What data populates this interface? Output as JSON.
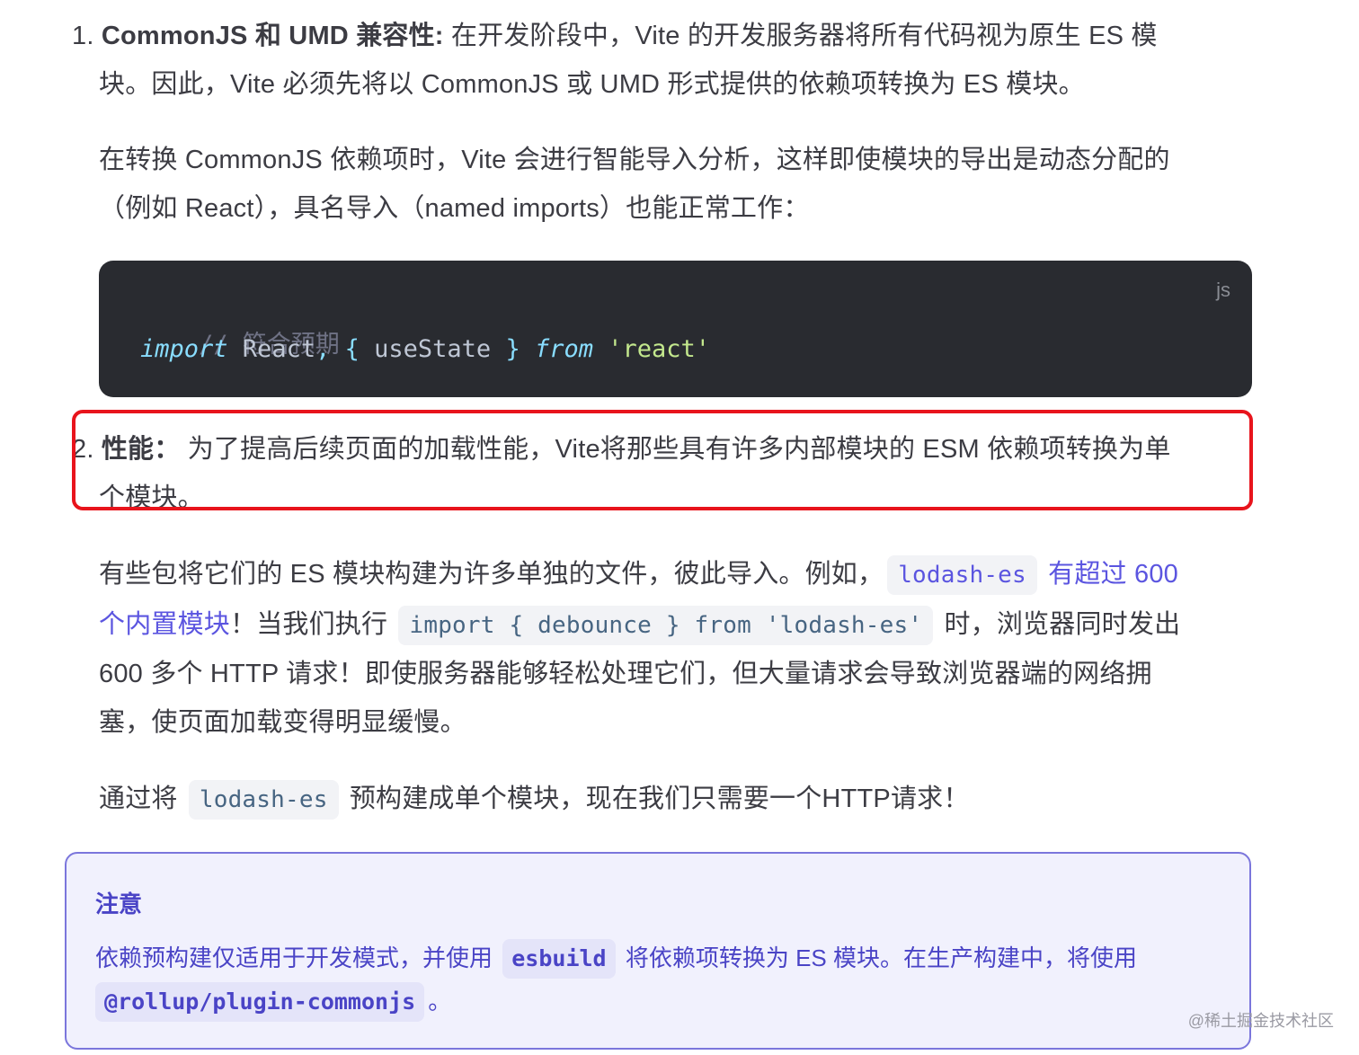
{
  "list": {
    "item1": {
      "number": "1.",
      "title": "CommonJS 和 UMD 兼容性:",
      "line1_rest": " 在开发阶段中，Vite 的开发服务器将所有代码视为原生 ES 模",
      "line2": "块。因此，Vite 必须先将以 CommonJS 或 UMD 形式提供的依赖项转换为 ES 模块。",
      "para_line1": "在转换 CommonJS 依赖项时，Vite 会进行智能导入分析，这样即使模块的导出是动态分配的",
      "para_line2": "（例如 React），具名导入（named imports）也能正常工作："
    },
    "item2": {
      "number": "2.",
      "title": "性能：",
      "line1_rest": " 为了提高后续页面的加载性能，Vite将那些具有许多内部模块的 ESM 依赖项转换为单",
      "line2": "个模块。"
    }
  },
  "code_block": {
    "language": "js",
    "comment": "// 符合预期",
    "tokens": {
      "import_kw": "import",
      "react_ident": " React",
      "comma": ",",
      "open_brace": " {",
      "use_state": " useState",
      "close_brace": " }",
      "from_kw": " from",
      "space": " ",
      "module": "'react'"
    }
  },
  "paragraph1": {
    "line1_text": "有些包将它们的 ES 模块构建为许多单独的文件，彼此导入。例如，",
    "line1_code": "lodash-es",
    "line1_link": "有超过 600",
    "line2_link": "个内置模块",
    "line2_text_a": "！当我们执行",
    "line2_code": "import { debounce } from 'lodash-es'",
    "line2_text_b": "时，浏览器同时发出",
    "line3": "600 多个 HTTP 请求！即使服务器能够轻松处理它们，但大量请求会导致浏览器端的网络拥",
    "line4": "塞，使页面加载变得明显缓慢。"
  },
  "paragraph2": {
    "text_a": "通过将",
    "code": "lodash-es",
    "text_b": "预构建成单个模块，现在我们只需要一个HTTP请求！"
  },
  "tip": {
    "title": "注意",
    "line1_a": "依赖预构建仅适用于开发模式，并使用",
    "line1_code": "esbuild",
    "line1_b": "将依赖项转换为 ES 模块。在生产构建中，将使用",
    "line2_code": "@rollup/plugin-commonjs",
    "line2_b": "。"
  },
  "watermark": "@稀土掘金技术社区",
  "colors": {
    "text": "#3c3c43",
    "link": "#5b55e0",
    "highlight_border": "#e8141c",
    "tip_text": "#4a44c6",
    "tip_bg": "#f1f1fd",
    "code_bg": "#292b30"
  }
}
